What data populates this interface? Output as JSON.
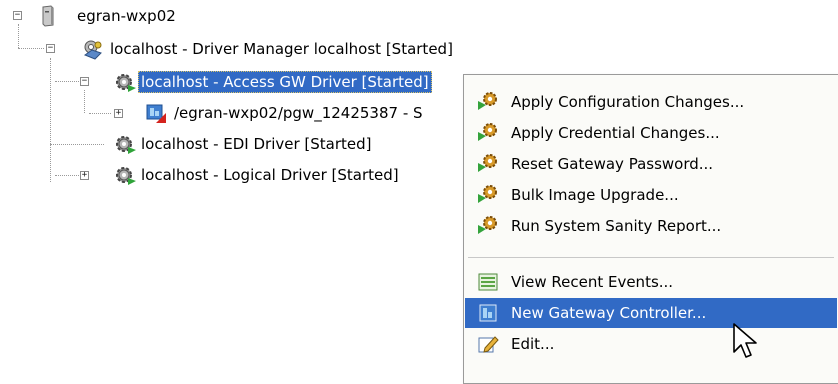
{
  "tree": {
    "root": {
      "label": "egran-wxp02",
      "icon": "server-icon"
    },
    "manager": {
      "label": "localhost - Driver Manager localhost [Started]",
      "icon": "driver-manager-icon"
    },
    "access_gw": {
      "label": "localhost - Access GW Driver [Started]",
      "icon": "gear-driver-icon"
    },
    "gateway": {
      "label": "/egran-wxp02/pgw_12425387 - S",
      "icon": "gateway-error-icon"
    },
    "edi": {
      "label": "localhost - EDI Driver [Started]",
      "icon": "gear-driver-icon"
    },
    "logical": {
      "label": "localhost - Logical Driver [Started]",
      "icon": "gear-driver-icon"
    }
  },
  "menu": {
    "items": [
      {
        "label": "Apply Configuration Changes...",
        "icon": "apply-config-icon"
      },
      {
        "label": "Apply Credential Changes...",
        "icon": "apply-credential-icon"
      },
      {
        "label": "Reset Gateway Password...",
        "icon": "reset-password-icon"
      },
      {
        "label": "Bulk Image Upgrade...",
        "icon": "bulk-upgrade-icon"
      },
      {
        "label": "Run System Sanity Report...",
        "icon": "sanity-report-icon"
      },
      {
        "label": "View Recent Events...",
        "icon": "events-list-icon"
      },
      {
        "label": "New Gateway Controller...",
        "icon": "gateway-controller-icon"
      },
      {
        "label": "Edit...",
        "icon": "edit-icon"
      }
    ],
    "highlighted": "New Gateway Controller..."
  },
  "colors": {
    "selection": "#316ac5",
    "menu_bg": "#fbfbf8"
  }
}
